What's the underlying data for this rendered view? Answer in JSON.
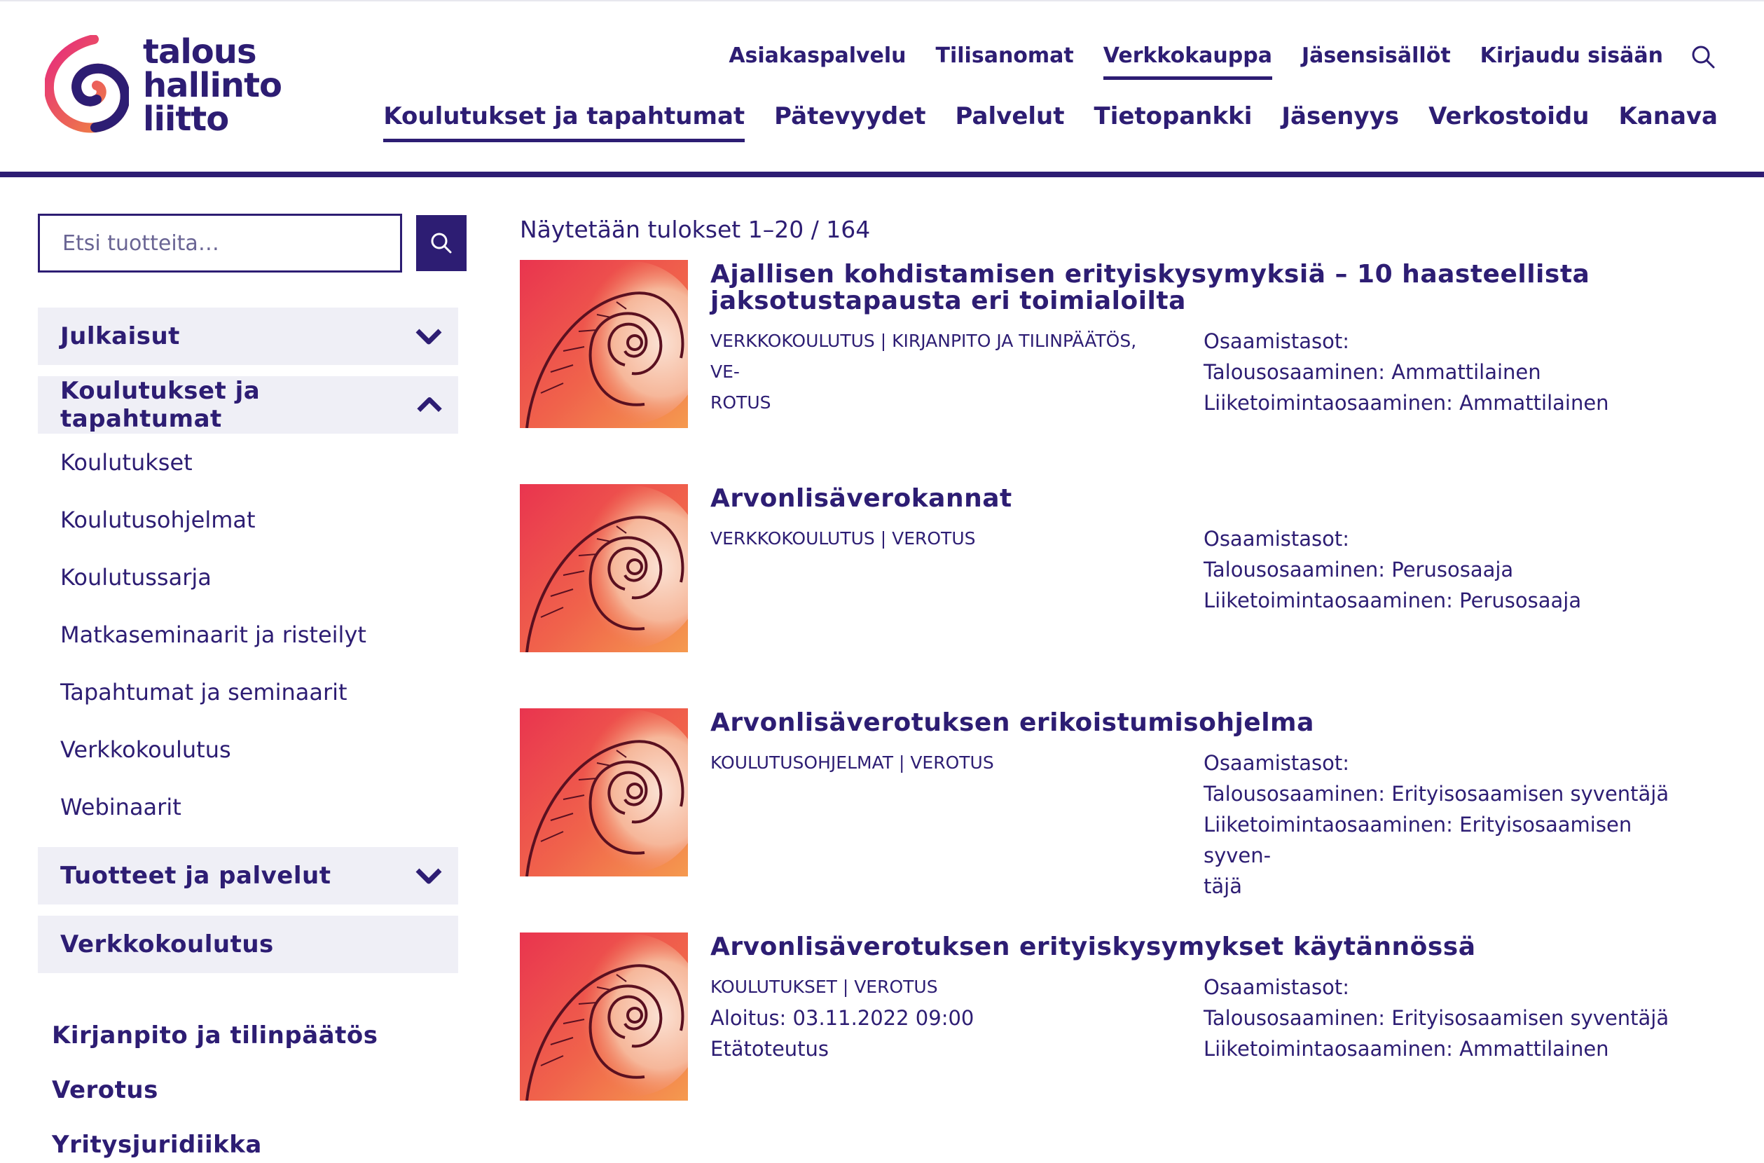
{
  "brand": {
    "logo_lines": [
      "talous",
      "hallinto",
      "liitto"
    ],
    "colors": {
      "primary": "#2d1d73",
      "accent_pink": "#e6287f",
      "accent_orange": "#f08c3c",
      "panel": "#efeff6"
    }
  },
  "top_nav": [
    {
      "label": "Asiakaspalvelu",
      "active": false
    },
    {
      "label": "Tilisanomat",
      "active": false
    },
    {
      "label": "Verkkokauppa",
      "active": true
    },
    {
      "label": "Jäsensisällöt",
      "active": false
    },
    {
      "label": "Kirjaudu sisään",
      "active": false
    }
  ],
  "main_nav": [
    {
      "label": "Koulutukset ja tapahtumat",
      "active": true
    },
    {
      "label": "Pätevyydet",
      "active": false
    },
    {
      "label": "Palvelut",
      "active": false
    },
    {
      "label": "Tietopankki",
      "active": false
    },
    {
      "label": "Jäsenyys",
      "active": false
    },
    {
      "label": "Verkostoidu",
      "active": false
    },
    {
      "label": "Kanava",
      "active": false
    }
  ],
  "sidebar": {
    "search_placeholder": "Etsi tuotteita…",
    "accordion": {
      "publications": "Julkaisut",
      "trainings": "Koulutukset ja tapahtumat",
      "trainings_items": [
        "Koulutukset",
        "Koulutusohjelmat",
        "Koulutussarja",
        "Matkaseminaarit ja risteilyt",
        "Tapahtumat ja seminaarit",
        "Verkkokoulutus",
        "Webinaarit"
      ],
      "products": "Tuotteet ja palvelut",
      "online": "Verkkokoulutus"
    },
    "categories": [
      "Kirjanpito ja tilinpäätös",
      "Verotus",
      "Yritysjuridiikka"
    ]
  },
  "results": {
    "count_text": "Näytetään tulokset 1–20 / 164",
    "items": [
      {
        "title": "Ajallisen kohdistamisen erityiskysymyksiä – 10 haasteellista jaksotustapausta eri toimialoilta",
        "cats_1": "VERKKOKOULUTUS | KIRJANPITO JA TILINPÄÄTÖS, VE-",
        "cats_2": "ROTUS",
        "levels_label": "Osaamistasot:",
        "level_1": "Talousosaaminen: Ammattilainen",
        "level_2": "Liiketoimintaosaaminen: Ammattilainen"
      },
      {
        "title": "Arvonlisäverokannat",
        "cats_1": "VERKKOKOULUTUS | VEROTUS",
        "levels_label": "Osaamistasot:",
        "level_1": "Talousosaaminen: Perusosaaja",
        "level_2": "Liiketoimintaosaaminen: Perusosaaja"
      },
      {
        "title": "Arvonlisäverotuksen erikoistumisohjelma",
        "cats_1": "KOULUTUSOHJELMAT | VEROTUS",
        "levels_label": "Osaamistasot:",
        "level_1": "Talousosaaminen: Erityisosaamisen syventäjä",
        "level_2": "Liiketoimintaosaaminen: Erityisosaamisen syven-",
        "level_3": "täjä"
      },
      {
        "title": "Arvonlisäverotuksen erityiskysymykset käytännössä",
        "cats_1": "KOULUTUKSET | VEROTUS",
        "start": "Aloitus: 03.11.2022 09:00",
        "mode": "Etätoteutus",
        "levels_label": "Osaamistasot:",
        "level_1": "Talousosaaminen: Erityisosaamisen syventäjä",
        "level_2": "Liiketoimintaosaaminen: Ammattilainen"
      }
    ]
  }
}
